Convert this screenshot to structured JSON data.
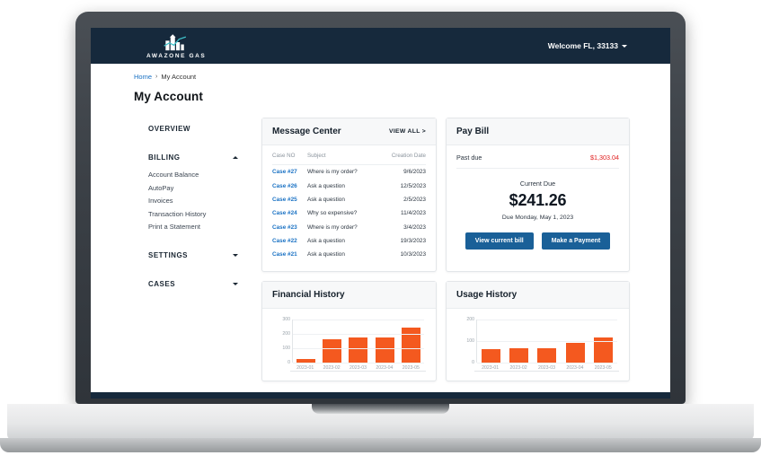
{
  "brand": {
    "name": "AWAZONE GAS",
    "logo_icon": "building-bar-chart-icon"
  },
  "header": {
    "welcome": "Welcome FL, 33133",
    "chevron_icon": "chevron-down-icon"
  },
  "breadcrumb": {
    "home": "Home",
    "separator": "›",
    "current": "My Account"
  },
  "page_title": "My Account",
  "sidebar": {
    "overview": "OVERVIEW",
    "billing": {
      "label": "BILLING",
      "caret_icon": "caret-up-icon",
      "items": [
        "Account Balance",
        "AutoPay",
        "Invoices",
        "Transaction History",
        "Print a Statement"
      ]
    },
    "settings": {
      "label": "SETTINGS",
      "caret_icon": "caret-down-icon"
    },
    "cases": {
      "label": "CASES",
      "caret_icon": "caret-down-icon"
    }
  },
  "message_center": {
    "title": "Message Center",
    "view_all": "VIEW ALL >",
    "columns": [
      "Case NO",
      "Subject",
      "Creation Date"
    ],
    "rows": [
      {
        "case": "Case #27",
        "subject": "Where is my order?",
        "date": "9/6/2023"
      },
      {
        "case": "Case #26",
        "subject": "Ask a question",
        "date": "12/5/2023"
      },
      {
        "case": "Case #25",
        "subject": "Ask a question",
        "date": "2/5/2023"
      },
      {
        "case": "Case #24",
        "subject": "Why so expensive?",
        "date": "11/4/2023"
      },
      {
        "case": "Case #23",
        "subject": "Where is my order?",
        "date": "3/4/2023"
      },
      {
        "case": "Case #22",
        "subject": "Ask a question",
        "date": "19/3/2023"
      },
      {
        "case": "Case #21",
        "subject": "Ask a question",
        "date": "10/3/2023"
      }
    ]
  },
  "pay_bill": {
    "title": "Pay Bill",
    "past_due_label": "Past due",
    "past_due_amount": "$1,303.04",
    "current_due_label": "Current Due",
    "current_due_amount": "$241.26",
    "due_date": "Due Monday, May 1, 2023",
    "view_bill_button": "View current bill",
    "make_payment_button": "Make a Payment"
  },
  "colors": {
    "navy": "#16293c",
    "orange": "#f4591f",
    "blue_button": "#1a6098",
    "link_blue": "#1a72c4",
    "red": "#e02020"
  },
  "chart_data": [
    {
      "type": "bar",
      "title": "Financial History",
      "categories": [
        "2023-01",
        "2023-02",
        "2023-03",
        "2023-04",
        "2023-05"
      ],
      "values": [
        20,
        160,
        175,
        175,
        240
      ],
      "yticks": [
        0,
        100,
        200,
        300
      ],
      "ylim": [
        0,
        300
      ],
      "xlabel": "",
      "ylabel": "",
      "grid": true,
      "legend": "none",
      "color": "#f4591f"
    },
    {
      "type": "bar",
      "title": "Usage History",
      "categories": [
        "2023-01",
        "2023-02",
        "2023-03",
        "2023-04",
        "2023-05"
      ],
      "values": [
        60,
        65,
        65,
        90,
        115
      ],
      "yticks": [
        0,
        100,
        200
      ],
      "ylim": [
        0,
        200
      ],
      "xlabel": "",
      "ylabel": "",
      "grid": true,
      "legend": "none",
      "color": "#f4591f"
    }
  ]
}
